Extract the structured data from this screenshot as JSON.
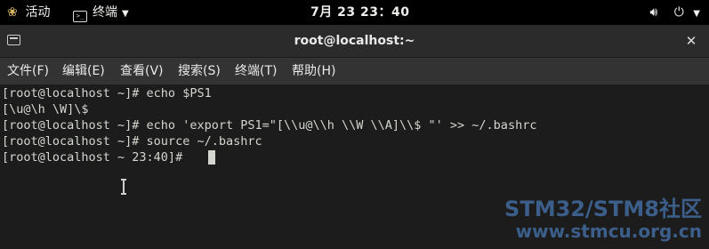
{
  "topbar": {
    "activities_label": "活动",
    "activities_icon": "gnome-foot-icon",
    "app_menu_label": "终端",
    "app_menu_icon": "terminal-icon",
    "clock": "7月 23  23：40",
    "status_icons": [
      "volume-icon",
      "power-icon",
      "dropdown-icon"
    ]
  },
  "window": {
    "title": "root@localhost:~",
    "new_tab_icon": "new-tab-icon",
    "close_icon": "close-icon"
  },
  "menubar": {
    "items": [
      {
        "label": "文件(F)"
      },
      {
        "label": "编辑(E)"
      },
      {
        "label": "查看(V)"
      },
      {
        "label": "搜索(S)"
      },
      {
        "label": "终端(T)"
      },
      {
        "label": "帮助(H)"
      }
    ]
  },
  "terminal": {
    "lines": [
      "[root@localhost ~]# echo $PS1",
      "[\\u@\\h \\W]\\$",
      "[root@localhost ~]# echo 'export PS1=\"[\\\\u@\\\\h \\\\W \\\\A]\\\\$ \"' >> ~/.bashrc",
      "[root@localhost ~]# source ~/.bashrc",
      "[root@localhost ~ 23:40]# "
    ]
  },
  "watermark": {
    "line1": "STM32/STM8社区",
    "line2": "www.stmcu.org.cn"
  },
  "colors": {
    "topbar_bg": "#000000",
    "headerbar_bg": "#2b2b2b",
    "menubar_bg": "#333333",
    "terminal_bg": "#1c1c1c",
    "terminal_fg": "#d3d7cf",
    "watermark": "#3b5e8a"
  }
}
